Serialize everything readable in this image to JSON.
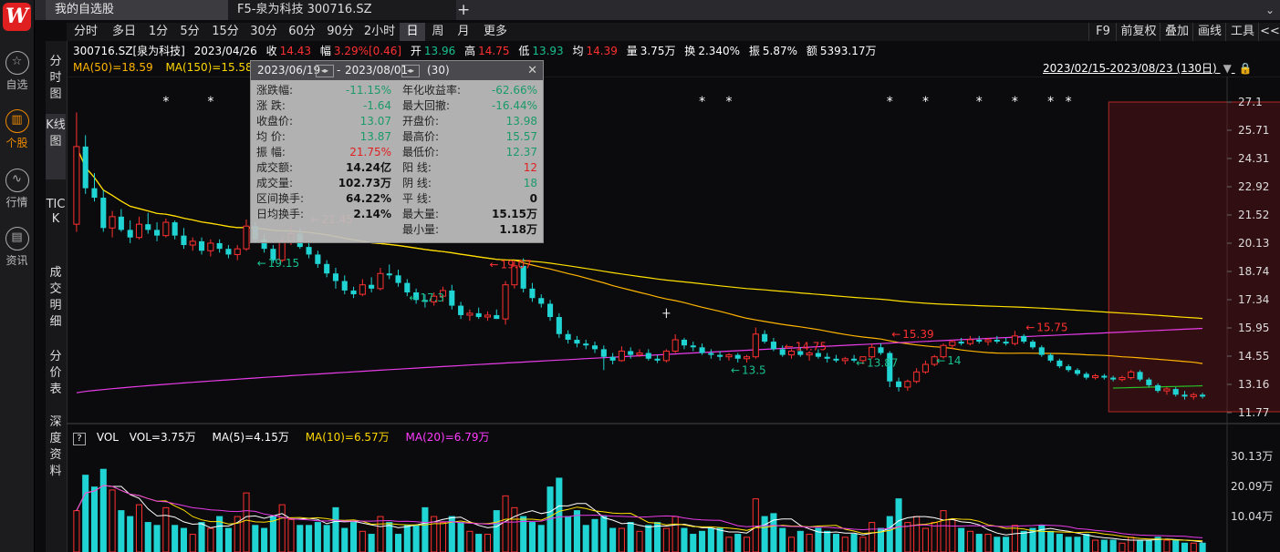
{
  "app": {
    "logo": "W"
  },
  "nav": [
    {
      "label": "自选",
      "icon": "star-icon",
      "glyph": "☆"
    },
    {
      "label": "个股",
      "icon": "stock-chart-icon",
      "glyph": "▥"
    },
    {
      "label": "行情",
      "icon": "market-trend-icon",
      "glyph": "∿"
    },
    {
      "label": "资讯",
      "icon": "news-icon",
      "glyph": "▤"
    }
  ],
  "tabs": {
    "tab1": "我的自选股",
    "tab2": "F5-泉为科技 300716.SZ",
    "add": "+",
    "dropdown": "⌄"
  },
  "periods": [
    "分时",
    "多日",
    "1分",
    "5分",
    "15分",
    "30分",
    "60分",
    "90分",
    "2小时",
    "日",
    "周",
    "月",
    "更多"
  ],
  "active_period": "日",
  "tools": [
    "F9",
    "前复权",
    "叠加",
    "画线",
    "工具",
    "<<"
  ],
  "side_tabs": [
    "分时图",
    "K线图",
    "TICK",
    "成交明细",
    "分价表",
    "深度资料"
  ],
  "info": {
    "code": "300716.SZ[泉为科技]",
    "date": "2023/04/26",
    "close_label": "收",
    "close": "14.43",
    "range_label": "幅",
    "range": "3.29%[0.46]",
    "open_label": "开",
    "open": "13.96",
    "high_label": "高",
    "high": "14.75",
    "low_label": "低",
    "low": "13.93",
    "avg_label": "均",
    "avg": "14.39",
    "vol_label": "量",
    "vol": "3.75万",
    "turnover_label": "换",
    "turnover": "2.340%",
    "amp_label": "振",
    "amp": "5.87%",
    "amount_label": "额",
    "amount": "5393.17万"
  },
  "ma": {
    "ma50": "MA(50)=18.59",
    "ma150": "MA(150)=15.58",
    "ma_cut": "M"
  },
  "date_range": "2023/02/15-2023/08/23 (130日)",
  "popup": {
    "start": "2023/06/19",
    "end": "2023/08/01",
    "count": "(30)",
    "sep": "-",
    "left": [
      {
        "label": "涨跌幅:",
        "value": "-11.15%",
        "c": "g"
      },
      {
        "label": "涨   跌:",
        "value": "-1.64",
        "c": "g"
      },
      {
        "label": "收盘价:",
        "value": "13.07",
        "c": "g"
      },
      {
        "label": "均   价:",
        "value": "13.87",
        "c": "g"
      },
      {
        "label": "振   幅:",
        "value": "21.75%",
        "c": "r"
      },
      {
        "label": "成交额:",
        "value": "14.24亿",
        "c": "k"
      },
      {
        "label": "成交量:",
        "value": "102.73万",
        "c": "k"
      },
      {
        "label": "区间换手:",
        "value": "64.22%",
        "c": "k"
      },
      {
        "label": "日均换手:",
        "value": "2.14%",
        "c": "k"
      }
    ],
    "right": [
      {
        "label": "年化收益率:",
        "value": "-62.66%",
        "c": "g"
      },
      {
        "label": "最大回撤:",
        "value": "-16.44%",
        "c": "g"
      },
      {
        "label": "开盘价:",
        "value": "13.98",
        "c": "g"
      },
      {
        "label": "最高价:",
        "value": "15.57",
        "c": "g"
      },
      {
        "label": "最低价:",
        "value": "12.37",
        "c": "g"
      },
      {
        "label": "阳   线:",
        "value": "12",
        "c": "r"
      },
      {
        "label": "阴   线:",
        "value": "18",
        "c": "g"
      },
      {
        "label": "平   线:",
        "value": "0",
        "c": "k"
      },
      {
        "label": "最大量:",
        "value": "15.15万",
        "c": "k"
      },
      {
        "label": "最小量:",
        "value": "1.18万",
        "c": "k"
      }
    ]
  },
  "price_axis": [
    "27.1",
    "25.71",
    "24.31",
    "22.92",
    "21.52",
    "20.13",
    "18.74",
    "17.34",
    "15.95",
    "14.55",
    "13.16",
    "11.77"
  ],
  "volume_axis": [
    "30.13万",
    "20.09万",
    "10.04万"
  ],
  "volume_header": {
    "q": "?",
    "name": "VOL",
    "vol": "VOL=3.75万",
    "ma5": "MA(5)=4.15万",
    "ma10": "MA(10)=6.57万",
    "ma20": "MA(20)=6.79万"
  },
  "annotations": [
    {
      "text": "21.45",
      "price": 21.45,
      "day": 26,
      "dir": "left-red"
    },
    {
      "text": "19.15",
      "price": 19.15,
      "day": 20,
      "dir": "left-green"
    },
    {
      "text": "19.07",
      "price": 19.07,
      "day": 46,
      "dir": "left-red"
    },
    {
      "text": "17.3",
      "price": 17.3,
      "day": 37,
      "dir": "left-green"
    },
    {
      "text": "14.75",
      "price": 14.75,
      "day": 79,
      "dir": "left-red"
    },
    {
      "text": "15.39",
      "price": 15.39,
      "day": 91,
      "dir": "left-red"
    },
    {
      "text": "13.5",
      "price": 13.5,
      "day": 73,
      "dir": "left-green"
    },
    {
      "text": "13.87",
      "price": 13.87,
      "day": 87,
      "dir": "left-green"
    },
    {
      "text": "14",
      "price": 14.0,
      "day": 96,
      "dir": "left-green"
    },
    {
      "text": "15.75",
      "price": 15.75,
      "day": 106,
      "dir": "left-red"
    },
    {
      "text": "12.37",
      "price": 12.37,
      "day": 132,
      "dir": "left-green"
    },
    {
      "text": "15.57",
      "price": 15.57,
      "day": 152,
      "dir": "left-red"
    },
    {
      "text": "11.94",
      "price": 11.94,
      "day": 186,
      "dir": "center-green"
    },
    {
      "text": "11.94",
      "price": 11.94,
      "day": 192,
      "dir": "left-green"
    }
  ],
  "chart_data": {
    "type": "candlestick",
    "y_range": [
      11.3,
      27.7
    ],
    "volume_range_wan": [
      0,
      33
    ],
    "candles": [
      [
        21.2,
        27.1,
        20.8,
        25.3,
        14
      ],
      [
        25.3,
        25.9,
        22.8,
        23.1,
        26
      ],
      [
        23.1,
        23.9,
        22.4,
        22.6,
        22
      ],
      [
        22.6,
        23.0,
        20.8,
        21.0,
        28
      ],
      [
        21.0,
        21.9,
        20.5,
        21.6,
        21
      ],
      [
        21.6,
        22.0,
        20.8,
        20.9,
        14
      ],
      [
        20.9,
        21.4,
        20.2,
        20.5,
        12
      ],
      [
        20.5,
        21.6,
        20.4,
        21.2,
        16
      ],
      [
        21.2,
        21.8,
        20.7,
        20.9,
        10
      ],
      [
        20.9,
        21.3,
        20.3,
        20.6,
        9
      ],
      [
        20.6,
        21.5,
        20.5,
        21.3,
        15
      ],
      [
        21.3,
        21.4,
        20.4,
        20.6,
        9
      ],
      [
        20.6,
        21.0,
        19.9,
        20.1,
        8
      ],
      [
        20.1,
        20.5,
        19.8,
        20.3,
        6
      ],
      [
        20.3,
        20.5,
        19.6,
        19.8,
        10
      ],
      [
        19.8,
        20.4,
        19.5,
        20.2,
        8
      ],
      [
        20.2,
        20.4,
        19.7,
        19.9,
        12
      ],
      [
        19.9,
        20.1,
        19.4,
        19.6,
        8
      ],
      [
        19.6,
        20.1,
        19.3,
        19.9,
        12
      ],
      [
        19.9,
        21.45,
        19.8,
        21.1,
        20
      ],
      [
        21.1,
        21.3,
        20.2,
        20.4,
        9
      ],
      [
        20.4,
        20.7,
        19.7,
        19.9,
        8
      ],
      [
        19.9,
        20.1,
        19.15,
        19.3,
        12
      ],
      [
        19.3,
        20.6,
        19.2,
        20.3,
        16
      ],
      [
        20.3,
        21.1,
        20.1,
        20.7,
        11
      ],
      [
        20.7,
        21.0,
        19.9,
        20.0,
        9
      ],
      [
        20.0,
        20.3,
        19.4,
        19.6,
        9
      ],
      [
        19.6,
        19.8,
        18.9,
        19.1,
        10
      ],
      [
        19.1,
        19.3,
        18.4,
        18.6,
        9
      ],
      [
        18.6,
        18.9,
        17.8,
        18.2,
        15
      ],
      [
        18.2,
        18.5,
        17.5,
        17.7,
        8
      ],
      [
        17.7,
        17.9,
        17.3,
        17.5,
        10
      ],
      [
        17.5,
        18.3,
        17.4,
        18.0,
        7
      ],
      [
        18.0,
        18.4,
        17.6,
        17.8,
        6
      ],
      [
        17.8,
        18.9,
        17.7,
        18.6,
        12
      ],
      [
        18.6,
        19.07,
        18.3,
        18.5,
        10
      ],
      [
        18.5,
        18.8,
        17.9,
        18.1,
        6
      ],
      [
        18.1,
        18.3,
        17.4,
        17.6,
        9
      ],
      [
        17.6,
        17.8,
        17.0,
        17.2,
        9
      ],
      [
        17.2,
        17.5,
        16.8,
        17.1,
        15
      ],
      [
        17.1,
        17.6,
        16.9,
        17.4,
        12
      ],
      [
        17.4,
        17.9,
        17.1,
        17.7,
        10
      ],
      [
        17.7,
        18.0,
        16.7,
        16.9,
        12
      ],
      [
        16.9,
        17.1,
        16.2,
        16.4,
        10
      ],
      [
        16.4,
        16.7,
        16.1,
        16.5,
        7
      ],
      [
        16.5,
        16.8,
        16.2,
        16.3,
        6
      ],
      [
        16.3,
        16.6,
        16.1,
        16.4,
        6
      ],
      [
        16.4,
        16.7,
        16.2,
        16.2,
        14
      ],
      [
        16.2,
        18.2,
        15.9,
        18.0,
        19
      ],
      [
        18.0,
        19.3,
        17.8,
        19.0,
        15
      ],
      [
        19.0,
        19.4,
        17.6,
        17.8,
        12
      ],
      [
        17.8,
        18.1,
        17.1,
        17.3,
        10
      ],
      [
        17.3,
        17.5,
        16.8,
        17.0,
        9
      ],
      [
        17.0,
        17.2,
        16.1,
        16.3,
        22
      ],
      [
        16.3,
        16.5,
        15.2,
        15.4,
        25
      ],
      [
        15.4,
        15.6,
        14.9,
        15.1,
        12
      ],
      [
        15.1,
        15.3,
        14.7,
        14.9,
        14
      ],
      [
        14.9,
        15.1,
        14.6,
        14.8,
        9
      ],
      [
        14.8,
        15.0,
        14.4,
        14.6,
        11
      ],
      [
        14.6,
        14.8,
        13.5,
        14.2,
        12
      ],
      [
        14.2,
        14.4,
        13.8,
        14.0,
        8
      ],
      [
        14.0,
        14.75,
        13.95,
        14.5,
        8
      ],
      [
        14.5,
        14.7,
        14.1,
        14.3,
        10
      ],
      [
        14.3,
        14.6,
        14.2,
        14.4,
        7
      ],
      [
        14.4,
        14.6,
        14.0,
        14.1,
        9
      ],
      [
        14.1,
        14.3,
        13.87,
        14.0,
        10
      ],
      [
        14.0,
        14.6,
        13.9,
        14.5,
        8
      ],
      [
        14.5,
        15.39,
        14.4,
        15.1,
        12
      ],
      [
        15.1,
        15.2,
        14.6,
        14.8,
        8
      ],
      [
        14.8,
        15.0,
        14.5,
        14.7,
        6
      ],
      [
        14.7,
        14.9,
        14.3,
        14.4,
        7
      ],
      [
        14.4,
        14.6,
        14.1,
        14.3,
        8
      ],
      [
        14.3,
        14.5,
        14.0,
        14.2,
        8
      ],
      [
        14.2,
        14.4,
        14.0,
        14.3,
        5
      ],
      [
        14.3,
        14.4,
        13.9,
        14.1,
        6
      ],
      [
        14.1,
        14.3,
        13.9,
        14.2,
        5
      ],
      [
        14.2,
        15.75,
        14.1,
        15.4,
        18
      ],
      [
        15.4,
        15.6,
        14.9,
        15.0,
        12
      ],
      [
        15.0,
        15.2,
        14.5,
        14.6,
        13
      ],
      [
        14.6,
        14.8,
        14.2,
        14.3,
        8
      ],
      [
        14.3,
        14.6,
        14.1,
        14.5,
        5
      ],
      [
        14.5,
        14.7,
        14.2,
        14.3,
        7
      ],
      [
        14.3,
        14.5,
        14.0,
        14.4,
        6
      ],
      [
        14.4,
        14.6,
        14.1,
        14.2,
        8
      ],
      [
        14.2,
        14.4,
        13.9,
        14.1,
        7
      ],
      [
        14.1,
        14.3,
        13.9,
        14.0,
        6
      ],
      [
        14.0,
        14.2,
        13.8,
        14.1,
        5
      ],
      [
        14.1,
        14.3,
        13.9,
        14.0,
        6
      ],
      [
        14.0,
        14.2,
        13.8,
        14.2,
        5
      ],
      [
        14.2,
        14.9,
        14.1,
        14.7,
        10
      ],
      [
        14.7,
        14.9,
        14.3,
        14.4,
        8
      ],
      [
        14.4,
        14.5,
        12.6,
        12.9,
        12
      ],
      [
        12.9,
        13.1,
        12.37,
        12.6,
        18
      ],
      [
        12.6,
        13.0,
        12.4,
        12.9,
        10
      ],
      [
        12.9,
        13.6,
        12.8,
        13.4,
        12
      ],
      [
        13.4,
        14.0,
        13.3,
        13.8,
        8
      ],
      [
        13.8,
        14.3,
        13.7,
        14.2,
        10
      ],
      [
        14.2,
        14.9,
        14.1,
        14.8,
        14
      ],
      [
        14.8,
        15.1,
        14.6,
        15.0,
        11
      ],
      [
        15.0,
        15.2,
        14.8,
        14.9,
        8
      ],
      [
        14.9,
        15.3,
        14.8,
        15.1,
        7
      ],
      [
        15.1,
        15.3,
        14.9,
        15.0,
        6
      ],
      [
        15.0,
        15.2,
        14.8,
        15.1,
        6
      ],
      [
        15.1,
        15.3,
        14.9,
        15.0,
        5
      ],
      [
        15.0,
        15.2,
        14.8,
        14.9,
        5
      ],
      [
        14.9,
        15.57,
        14.8,
        15.3,
        9
      ],
      [
        15.3,
        15.4,
        14.9,
        15.0,
        7
      ],
      [
        15.0,
        15.1,
        14.6,
        14.7,
        8
      ],
      [
        14.7,
        14.8,
        14.2,
        14.3,
        9
      ],
      [
        14.3,
        14.4,
        13.9,
        14.0,
        7
      ],
      [
        14.0,
        14.1,
        13.6,
        13.7,
        6
      ],
      [
        13.7,
        13.8,
        13.4,
        13.5,
        5
      ],
      [
        13.5,
        13.6,
        13.2,
        13.3,
        5
      ],
      [
        13.3,
        13.4,
        13.0,
        13.1,
        6
      ],
      [
        13.1,
        13.3,
        13.0,
        13.2,
        4
      ],
      [
        13.2,
        13.3,
        13.0,
        13.1,
        4
      ],
      [
        13.1,
        13.2,
        12.9,
        13.0,
        4
      ],
      [
        13.0,
        13.2,
        12.9,
        13.1,
        3
      ],
      [
        13.1,
        13.5,
        13.0,
        13.4,
        5
      ],
      [
        13.4,
        13.5,
        12.9,
        13.0,
        4
      ],
      [
        13.0,
        13.1,
        12.6,
        12.7,
        4
      ],
      [
        12.7,
        12.8,
        12.3,
        12.4,
        5
      ],
      [
        12.4,
        12.6,
        12.2,
        12.5,
        4
      ],
      [
        12.5,
        12.6,
        12.1,
        12.2,
        4
      ],
      [
        12.2,
        12.4,
        11.94,
        12.1,
        3
      ],
      [
        12.1,
        12.3,
        11.94,
        12.2,
        3
      ],
      [
        12.2,
        12.3,
        12.0,
        12.1,
        3
      ]
    ]
  }
}
